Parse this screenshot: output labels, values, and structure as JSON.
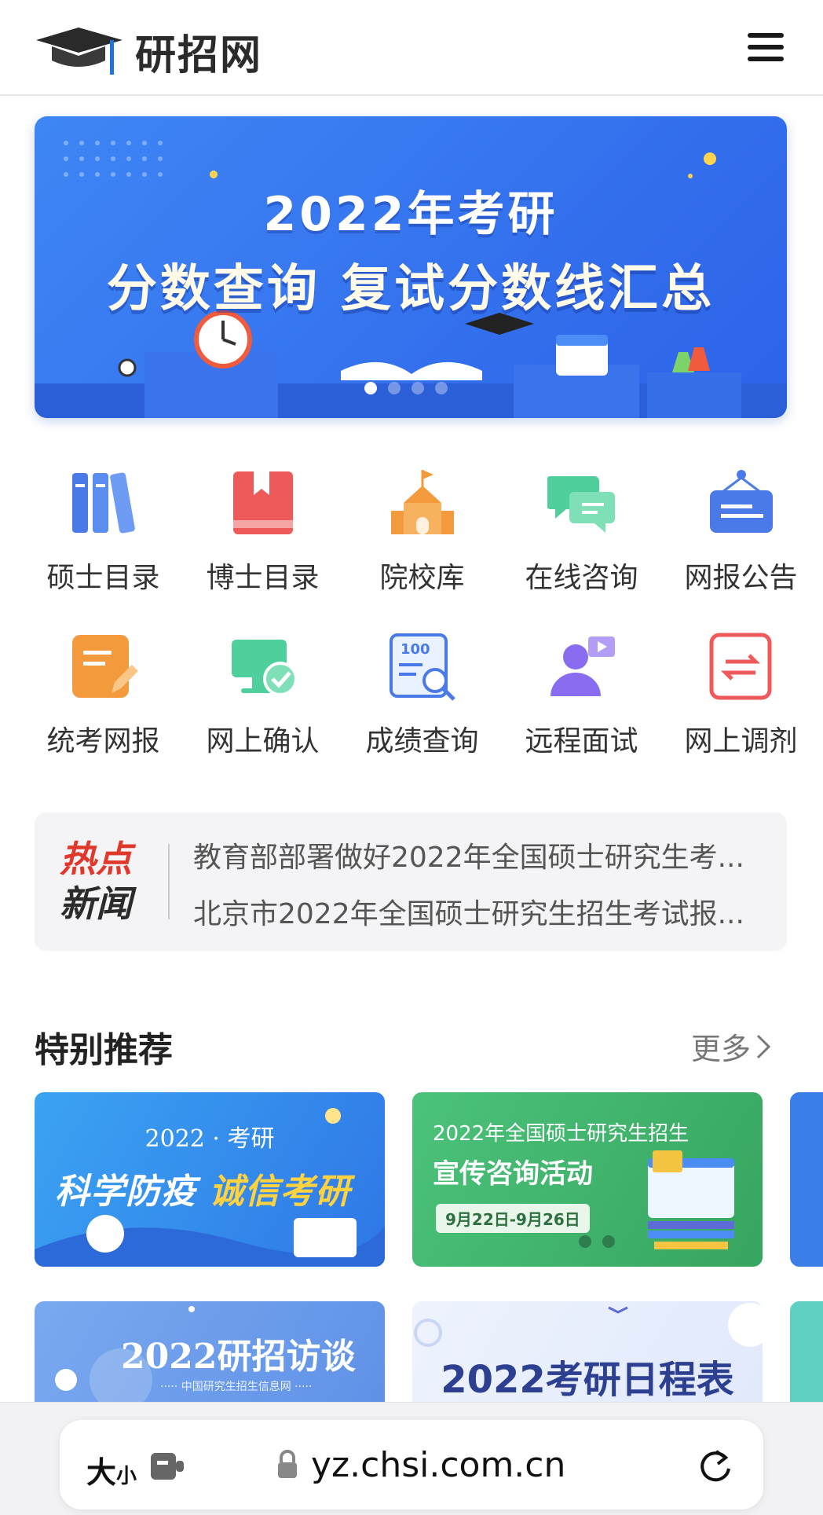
{
  "header": {
    "logo_text": "研招网",
    "menu_icon": "hamburger-menu-icon"
  },
  "banner": {
    "line1": "2022年考研",
    "line2": "分数查询 复试分数线汇总",
    "total_slides": 4,
    "active_slide": 1
  },
  "grid": [
    {
      "label": "硕士目录",
      "icon": "books-icon",
      "color": "#4a7ae8"
    },
    {
      "label": "博士目录",
      "icon": "bookmark-book-icon",
      "color": "#ee5a5a"
    },
    {
      "label": "院校库",
      "icon": "school-building-icon",
      "color": "#f39a3c"
    },
    {
      "label": "在线咨询",
      "icon": "chat-bubbles-icon",
      "color": "#4fcf9c"
    },
    {
      "label": "网报公告",
      "icon": "notice-board-icon",
      "color": "#4a7ae8"
    },
    {
      "label": "统考网报",
      "icon": "edit-document-icon",
      "color": "#f39a3c"
    },
    {
      "label": "网上确认",
      "icon": "computer-check-icon",
      "color": "#4fcf9c"
    },
    {
      "label": "成绩查询",
      "icon": "score-search-icon",
      "color": "#4a7ae8"
    },
    {
      "label": "远程面试",
      "icon": "video-user-icon",
      "color": "#8a6cf0"
    },
    {
      "label": "网上调剂",
      "icon": "transfer-icon",
      "color": "#ee5a5a"
    }
  ],
  "news": {
    "tag_line1": "热点",
    "tag_line2": "新闻",
    "items": [
      "教育部部署做好2022年全国硕士研究生考...",
      "北京市2022年全国硕士研究生招生考试报..."
    ]
  },
  "section": {
    "title": "特别推荐",
    "more": "更多"
  },
  "cards": {
    "card1_top": "2022 · 考研",
    "card1_main_a": "科学防疫",
    "card1_main_b": "诚信考研",
    "card2_top": "2022年全国硕士研究生招生",
    "card2_main": "宣传咨询活动",
    "card2_date": "9月22日-9月26日",
    "card4_main": "2022研招访谈",
    "card4_sub": "····· 中国研究生招生信息网 ·····",
    "card5_main": "2022考研日程表"
  },
  "browser": {
    "text_size_big": "大",
    "text_size_small": "小",
    "url": "yz.chsi.com.cn"
  },
  "colors": {
    "banner_blue": "#3373ee",
    "hot_red": "#e0382b"
  }
}
